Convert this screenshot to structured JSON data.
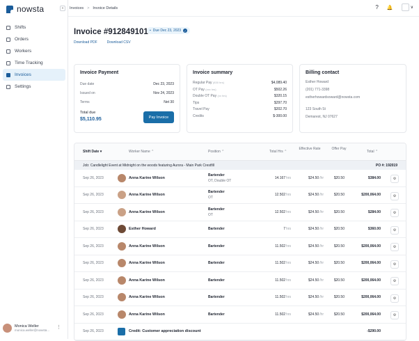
{
  "app": {
    "logo_text": "nowsta"
  },
  "sidebar": {
    "items": [
      {
        "label": "Shifts",
        "icon": "calendar-icon"
      },
      {
        "label": "Orders",
        "icon": "orders-icon"
      },
      {
        "label": "Workers",
        "icon": "workers-icon"
      },
      {
        "label": "Time Tracking",
        "icon": "clock-icon"
      },
      {
        "label": "Invoices",
        "icon": "invoice-icon",
        "active": true
      },
      {
        "label": "Settings",
        "icon": "gear-icon"
      }
    ],
    "user": {
      "name": "Monica Weller",
      "email": "monica.weller@nowsta..."
    }
  },
  "topbar": {
    "breadcrumbs": [
      "Invoices",
      "Invoice Details"
    ],
    "separator": ">",
    "collapse_glyph": "«",
    "help_glyph": "?",
    "bell_glyph": "🔔",
    "chevron_glyph": "∨"
  },
  "header": {
    "title": "Invoice #912849101",
    "due_badge": "Due Dec 23, 2023",
    "links": [
      "Download PDF",
      "Download CSV"
    ]
  },
  "payment": {
    "title": "Invoice Payment",
    "rows": [
      {
        "k": "Due date",
        "v": "Dec 23, 2023"
      },
      {
        "k": "Issued on",
        "v": "Nov 24, 2023"
      },
      {
        "k": "Terms",
        "v": "Net 30"
      }
    ],
    "total_label": "Total due",
    "total_value": "$5,110.95",
    "pay_button": "Pay Invoice"
  },
  "summary": {
    "title": "Invoice summary",
    "rows": [
      {
        "k": "Regular Pay",
        "hint": "(830 hrs)",
        "v": "$4,089.40"
      },
      {
        "k": "OT Pay",
        "hint": "(xxx hrs)",
        "v": "$502.26"
      },
      {
        "k": "Double OT Pay",
        "hint": "(xx hrs)",
        "v": "$320.15"
      },
      {
        "k": "Tips",
        "hint": "",
        "v": "$297.70"
      },
      {
        "k": "Travel Pay",
        "hint": "",
        "v": "$202.70"
      },
      {
        "k": "Credits",
        "hint": "",
        "v": "$-300.00"
      }
    ]
  },
  "billing": {
    "title": "Billing contact",
    "lines": [
      "Esther Howard",
      "(201) 771-3398",
      "estherhowardsoward@nowsta.com",
      "",
      "123 South St",
      "Demarest, NJ 07627"
    ]
  },
  "table": {
    "headers": {
      "date": "Shift Date",
      "worker": "Worker Name",
      "position": "Position",
      "hrs": "Total Hrs",
      "rate": "Effective Rate",
      "offer": "Offer Pay",
      "total": "Total"
    },
    "job": {
      "label": "Job: Candlelight Event at Midnight on the woods featuring Aurora - Main Park Crestfill",
      "po": "PO #: 192019"
    },
    "rows": [
      {
        "date": "Sep 26, 2023",
        "name": "Anna Karine Wilson",
        "pos": "Bartender",
        "pos2": "OT, Double OT",
        "hrs": "14.167",
        "rate": "$24.50",
        "offer": "$20.50",
        "total": "$384.00",
        "face": "f1"
      },
      {
        "date": "Sep 26, 2023",
        "name": "Anna Karine Wilson",
        "pos": "Bartender",
        "pos2": "OT",
        "hrs": "12.502",
        "rate": "$24.50",
        "offer": "$20.50",
        "total": "$200,064.00",
        "face": "f3"
      },
      {
        "date": "Sep 26, 2023",
        "name": "Anna Karine Wilson",
        "pos": "Bartender",
        "pos2": "OT",
        "hrs": "12.502",
        "rate": "$24.50",
        "offer": "$20.50",
        "total": "$284.00",
        "face": "f3"
      },
      {
        "date": "Sep 26, 2023",
        "name": "Esther Howard",
        "pos": "Bartender",
        "pos2": "",
        "hrs": "7",
        "rate": "$24.50",
        "offer": "$20.50",
        "total": "$360.00",
        "face": "f2"
      },
      {
        "date": "Sep 26, 2023",
        "name": "Anna Karine Wilson",
        "pos": "Bartender",
        "pos2": "",
        "hrs": "11.502",
        "rate": "$24.50",
        "offer": "$20.50",
        "total": "$200,064.00",
        "face": "f1"
      },
      {
        "date": "Sep 26, 2023",
        "name": "Anna Karine Wilson",
        "pos": "Bartender",
        "pos2": "",
        "hrs": "11.502",
        "rate": "$24.50",
        "offer": "$20.50",
        "total": "$200,064.00",
        "face": "f1"
      },
      {
        "date": "Sep 26, 2023",
        "name": "Anna Karine Wilson",
        "pos": "Bartender",
        "pos2": "",
        "hrs": "11.502",
        "rate": "$24.50",
        "offer": "$20.50",
        "total": "$200,064.00",
        "face": "f1"
      },
      {
        "date": "Sep 26, 2023",
        "name": "Anna Karine Wilson",
        "pos": "Bartender",
        "pos2": "",
        "hrs": "11.502",
        "rate": "$24.50",
        "offer": "$20.50",
        "total": "$200,064.00",
        "face": "f1"
      },
      {
        "date": "Sep 26, 2023",
        "name": "Anna Karine Wilson",
        "pos": "Bartender",
        "pos2": "",
        "hrs": "11.502",
        "rate": "$24.50",
        "offer": "$20.50",
        "total": "$200,064.00",
        "face": "f1"
      }
    ],
    "credit": {
      "date": "Sep 26, 2023",
      "label": "Credit: Customer appreciation discount",
      "total": "-$290.00"
    },
    "hrs_unit": "hrs",
    "rate_unit": "/hr"
  }
}
